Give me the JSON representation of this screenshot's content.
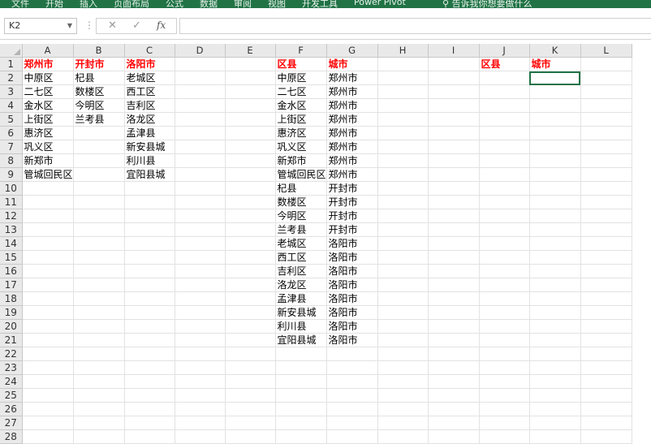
{
  "ribbon": {
    "menu_items": [
      "文件",
      "开始",
      "插入",
      "页面布局",
      "公式",
      "数据",
      "审阅",
      "视图",
      "开发工具",
      "Power Pivot"
    ],
    "tell_me": "告诉我你想要做什么"
  },
  "formula_bar": {
    "name_box": "K2",
    "cancel_glyph": "✕",
    "enter_glyph": "✓",
    "fx_glyph": "fx",
    "formula_value": ""
  },
  "sheet": {
    "columns": [
      "A",
      "B",
      "C",
      "D",
      "E",
      "F",
      "G",
      "H",
      "I",
      "J",
      "K",
      "L"
    ],
    "row_count": 28,
    "cells": {
      "A1": "郑州市",
      "B1": "开封市",
      "C1": "洛阳市",
      "F1": "区县",
      "G1": "城市",
      "J1": "区县",
      "K1": "城市",
      "A2": "中原区",
      "B2": "杞县",
      "C2": "老城区",
      "F2": "中原区",
      "G2": "郑州市",
      "A3": "二七区",
      "B3": "数楼区",
      "C3": "西工区",
      "F3": "二七区",
      "G3": "郑州市",
      "A4": "金水区",
      "B4": "今明区",
      "C4": "吉利区",
      "F4": "金水区",
      "G4": "郑州市",
      "A5": "上街区",
      "B5": "兰考县",
      "C5": "洛龙区",
      "F5": "上街区",
      "G5": "郑州市",
      "A6": "惠济区",
      "C6": "孟津县",
      "F6": "惠济区",
      "G6": "郑州市",
      "A7": "巩义区",
      "C7": "新安县城",
      "F7": "巩义区",
      "G7": "郑州市",
      "A8": "新郑市",
      "C8": "利川县",
      "F8": "新郑市",
      "G8": "郑州市",
      "A9": "管城回民区",
      "C9": "宜阳县城",
      "F9": "管城回民区",
      "G9": "郑州市",
      "F10": "杞县",
      "G10": "开封市",
      "F11": "数楼区",
      "G11": "开封市",
      "F12": "今明区",
      "G12": "开封市",
      "F13": "兰考县",
      "G13": "开封市",
      "F14": "老城区",
      "G14": "洛阳市",
      "F15": "西工区",
      "G15": "洛阳市",
      "F16": "吉利区",
      "G16": "洛阳市",
      "F17": "洛龙区",
      "G17": "洛阳市",
      "F18": "孟津县",
      "G18": "洛阳市",
      "F19": "新安县城",
      "G19": "洛阳市",
      "F20": "利川县",
      "G20": "洛阳市",
      "F21": "宜阳县城",
      "G21": "洛阳市"
    },
    "header_cells": [
      "A1",
      "B1",
      "C1",
      "F1",
      "G1",
      "J1",
      "K1"
    ],
    "selected_cell": "K2",
    "header_text_color": "#ff0000",
    "accent_color": "#217346"
  }
}
